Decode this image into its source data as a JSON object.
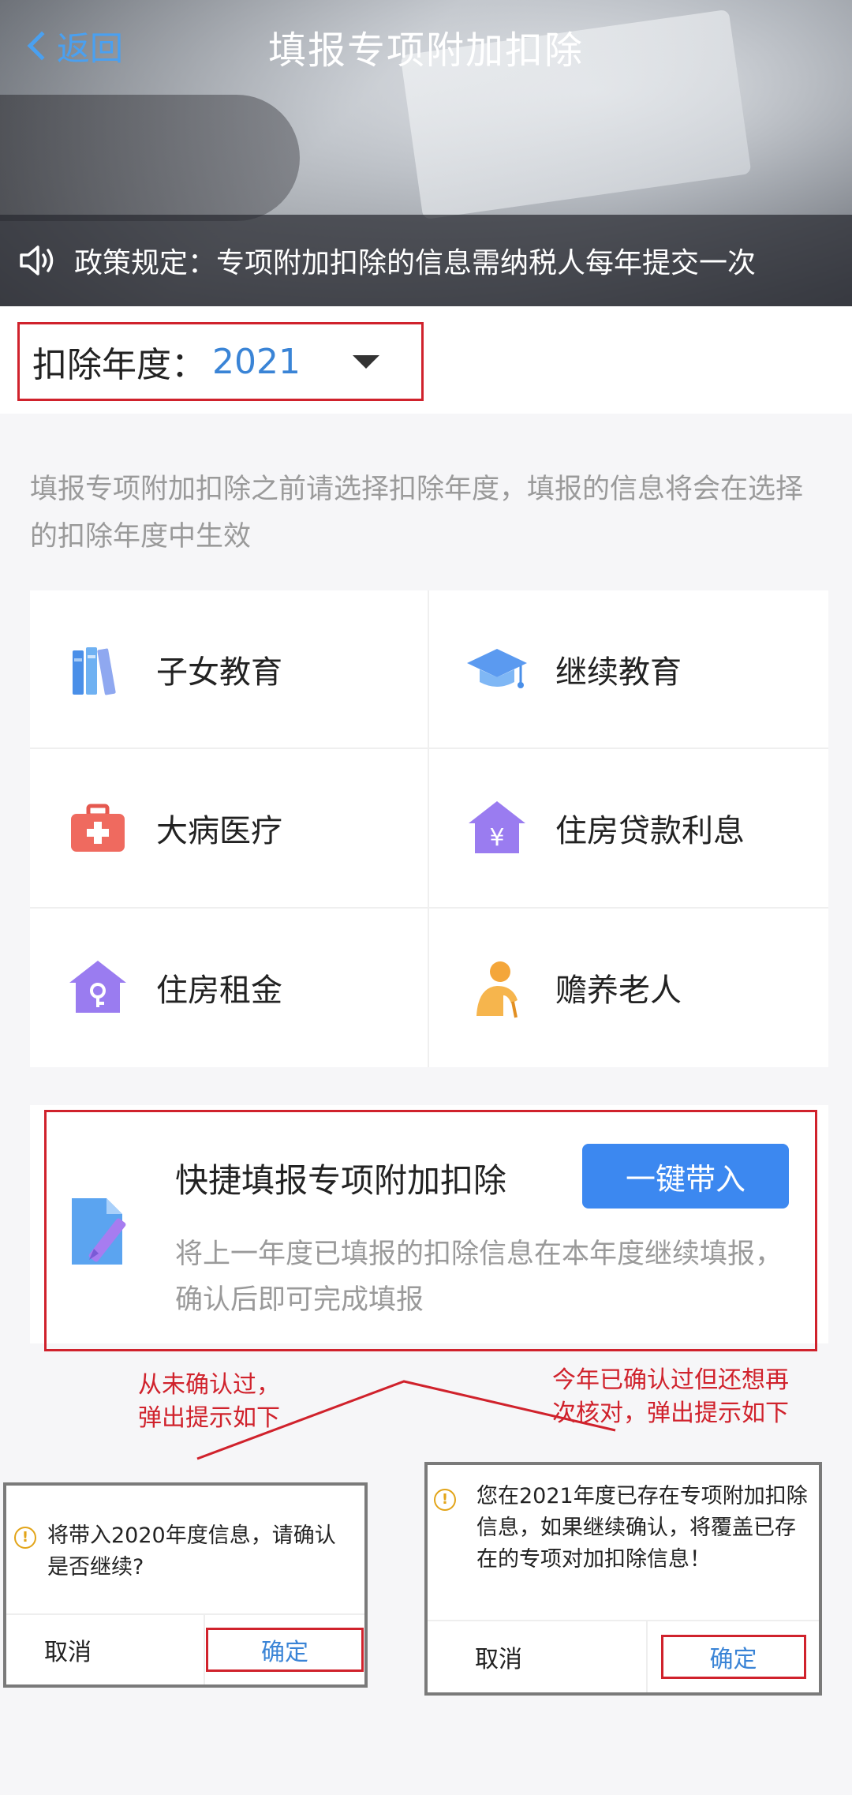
{
  "header": {
    "back_label": "返回",
    "title": "填报专项附加扣除",
    "notice": "政策规定：专项附加扣除的信息需纳税人每年提交一次"
  },
  "year_selector": {
    "label": "扣除年度：",
    "value": "2021"
  },
  "hint": "填报专项附加扣除之前请选择扣除年度，填报的信息将会在选择的扣除年度中生效",
  "categories": [
    {
      "label": "子女教育",
      "icon": "books-icon"
    },
    {
      "label": "继续教育",
      "icon": "graduation-cap-icon"
    },
    {
      "label": "大病医疗",
      "icon": "medical-kit-icon"
    },
    {
      "label": "住房贷款利息",
      "icon": "house-yuan-icon"
    },
    {
      "label": "住房租金",
      "icon": "house-key-icon"
    },
    {
      "label": "赡养老人",
      "icon": "elderly-person-icon"
    }
  ],
  "quick_fill": {
    "title": "快捷填报专项附加扣除",
    "button": "一键带入",
    "description": "将上一年度已填报的扣除信息在本年度继续填报，确认后即可完成填报"
  },
  "annotations": {
    "left_line1": "从未确认过，",
    "left_line2": "弹出提示如下",
    "right_line1": "今年已确认过但还想再",
    "right_line2": "次核对，弹出提示如下"
  },
  "dialog_first": {
    "message": "将带入2020年度信息，请确认是否继续?",
    "cancel": "取消",
    "confirm": "确定"
  },
  "dialog_second": {
    "message": "您在2021年度已存在专项附加扣除信息，如果继续确认，将覆盖已存在的专项对加扣除信息！",
    "cancel": "取消",
    "confirm": "确定"
  },
  "colors": {
    "accent_blue": "#3c88f0",
    "annotation_red": "#d0222c",
    "warning": "#e2a418"
  }
}
